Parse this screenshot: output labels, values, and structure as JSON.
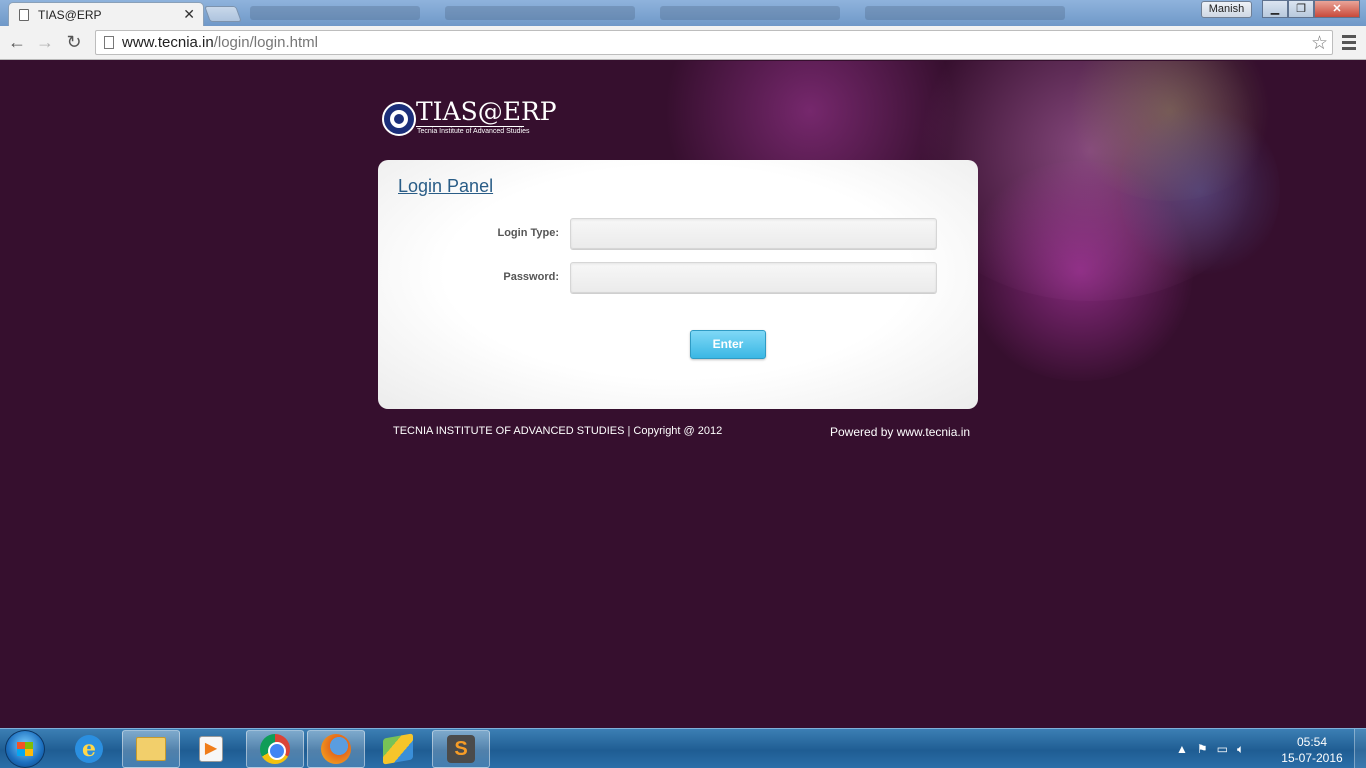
{
  "browser": {
    "tab_title": "TIAS@ERP",
    "url_host": "www.tecnia.in",
    "url_path": "/login/login.html",
    "profile_name": "Manish",
    "icons": {
      "back": "back-arrow-icon",
      "forward": "forward-arrow-icon",
      "reload": "reload-icon",
      "bookmark": "star-icon",
      "menu": "hamburger-menu-icon"
    }
  },
  "page": {
    "logo_text": "TIAS@ERP",
    "logo_subtitle": "Tecnia Institute of Advanced Studies",
    "panel_title": "Login Panel",
    "login_type_label": "Login Type:",
    "login_type_value": "",
    "password_label": "Password:",
    "password_value": "",
    "enter_label": "Enter",
    "footer_left": "TECNIA INSTITUTE OF ADVANCED STUDIES | Copyright @ 2012",
    "footer_right": "Powered by www.tecnia.in",
    "colors": {
      "background": "#360f2e",
      "title_link": "#2a5d87",
      "button": "#3ab7e4"
    }
  },
  "taskbar": {
    "apps": [
      "internet-explorer",
      "file-explorer",
      "media-player",
      "chrome",
      "firefox",
      "bluestacks",
      "sublime-text"
    ],
    "time": "05:54",
    "date": "15-07-2016"
  }
}
